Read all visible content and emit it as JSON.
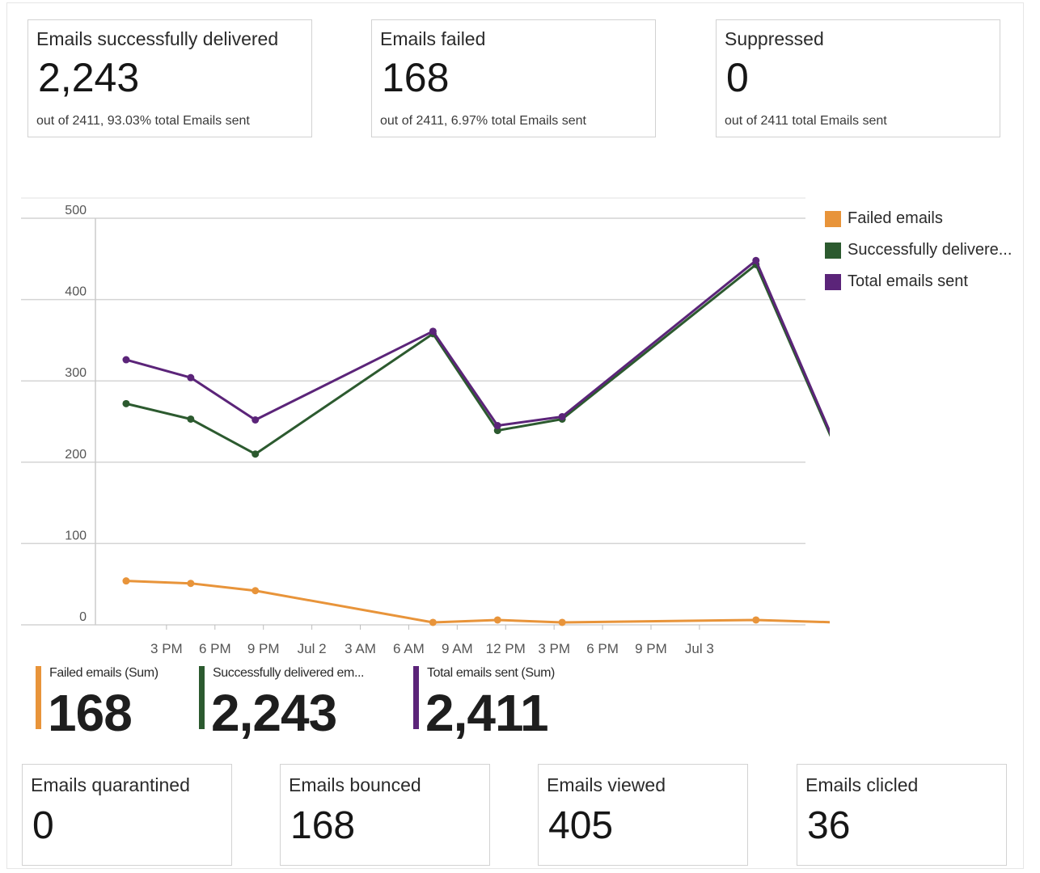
{
  "top_cards": [
    {
      "title": "Emails successfully delivered",
      "value": "2,243",
      "sub": "out of 2411, 93.03% total Emails sent"
    },
    {
      "title": "Emails failed",
      "value": "168",
      "sub": "out of 2411, 6.97% total Emails sent"
    },
    {
      "title": "Suppressed",
      "value": "0",
      "sub": "out of 2411 total Emails sent"
    }
  ],
  "chart_data": {
    "type": "line",
    "x": [
      "1 PM",
      "5 PM",
      "9 PM",
      "5 AM",
      "9 AM",
      "1 PM",
      "9 PM",
      "Jul 3 2 AM"
    ],
    "x_index": [
      1.5,
      5.5,
      9.5,
      20.5,
      24.5,
      28.5,
      40.5,
      45.5
    ],
    "x_ticks": [
      "3 PM",
      "6 PM",
      "9 PM",
      "Jul 2",
      "3 AM",
      "6 AM",
      "9 AM",
      "12 PM",
      "3 PM",
      "6 PM",
      "9 PM",
      "Jul 3"
    ],
    "x_tick_index": [
      4,
      7,
      10,
      13,
      16,
      19,
      22,
      25,
      28,
      31,
      34,
      37
    ],
    "ylim": [
      0,
      500
    ],
    "y_ticks": [
      0,
      100,
      200,
      300,
      400,
      500
    ],
    "grid": true,
    "legend_position": "right",
    "series": [
      {
        "name": "Failed emails",
        "color": "#e8943a",
        "values": [
          54,
          51,
          42,
          3,
          6,
          3,
          6,
          3
        ]
      },
      {
        "name": "Successfully delivere...",
        "color": "#2c5a2f",
        "values": [
          272,
          253,
          210,
          358,
          239,
          253,
          443,
          215
        ]
      },
      {
        "name": "Total emails sent",
        "color": "#5b2479",
        "values": [
          326,
          304,
          252,
          361,
          245,
          256,
          448,
          218
        ]
      }
    ]
  },
  "summary": [
    {
      "label": "Failed emails (Sum)",
      "value": "168",
      "color": "#e8943a"
    },
    {
      "label": "Successfully delivered em...",
      "value": "2,243",
      "color": "#2c5a2f"
    },
    {
      "label": "Total emails sent (Sum)",
      "value": "2,411",
      "color": "#5b2479"
    }
  ],
  "bottom_cards": [
    {
      "title": "Emails quarantined",
      "value": "0"
    },
    {
      "title": "Emails bounced",
      "value": "168"
    },
    {
      "title": "Emails viewed",
      "value": "405"
    },
    {
      "title": "Emails clicled",
      "value": "36"
    }
  ]
}
